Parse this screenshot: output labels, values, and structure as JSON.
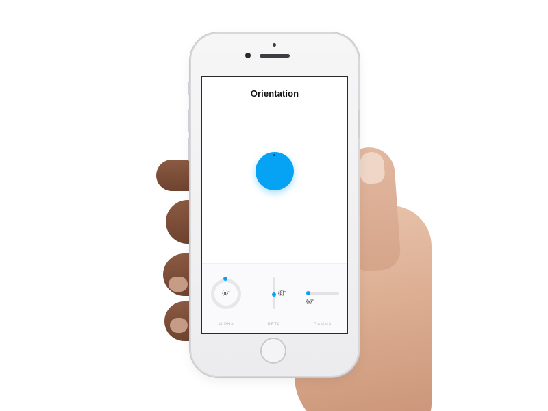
{
  "screen": {
    "title": "Orientation"
  },
  "ball": {
    "color": "#06a3f5"
  },
  "controls": {
    "alpha": {
      "label": "ALPHA",
      "value": "{α}°"
    },
    "beta": {
      "label": "BETA",
      "value": "{β}°"
    },
    "gamma": {
      "label": "GAMMA",
      "value": "{γ}°"
    }
  },
  "colors": {
    "accent": "#06a3f5",
    "track": "#e3e3e6",
    "label": "#b9b9be"
  }
}
